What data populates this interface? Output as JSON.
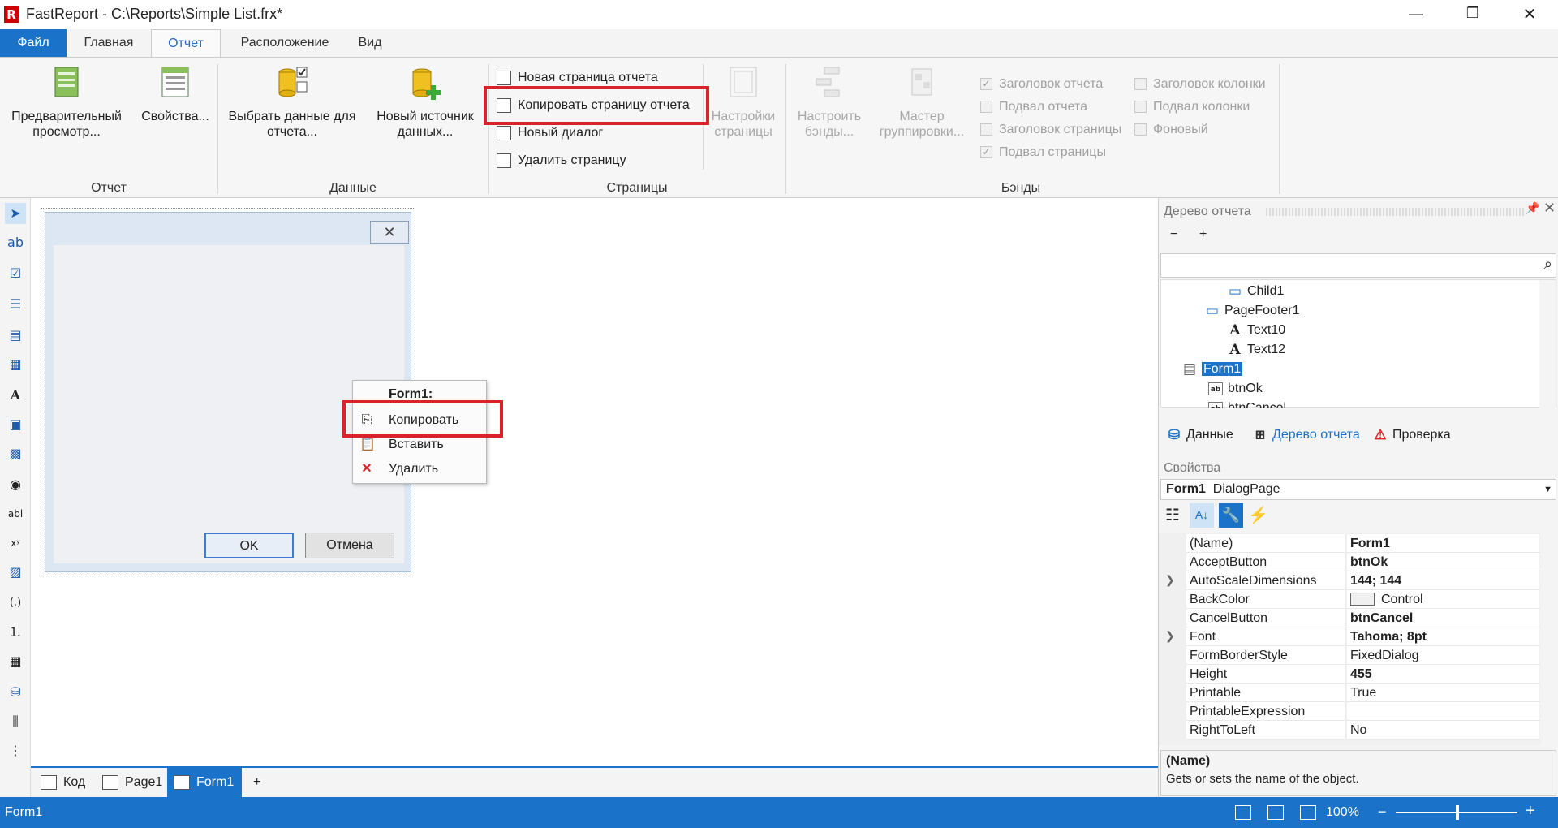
{
  "window": {
    "logo": "R",
    "title": "FastReport - C:\\Reports\\Simple List.frx*",
    "minimize": "—",
    "restore": "❐",
    "close": "✕"
  },
  "menu_tabs": [
    "Файл",
    "Главная",
    "Отчет",
    "Расположение",
    "Вид"
  ],
  "ribbon": {
    "group_report": {
      "label": "Отчет",
      "preview": "Предварительный просмотр...",
      "properties": "Свойства..."
    },
    "group_data": {
      "label": "Данные",
      "choose_data": "Выбрать данные для отчета...",
      "new_source": "Новый источник данных..."
    },
    "group_pages": {
      "label": "Страницы",
      "new_page": "Новая страница отчета",
      "copy_page": "Копировать страницу отчета",
      "new_dialog": "Новый диалог",
      "delete_page": "Удалить страницу",
      "page_settings": "Настройки страницы"
    },
    "group_bands": {
      "label": "Бэнды",
      "configure": "Настроить бэнды...",
      "group_wizard": "Мастер группировки...",
      "checks": [
        {
          "label": "Заголовок отчета",
          "checked": true
        },
        {
          "label": "Подвал отчета",
          "checked": false
        },
        {
          "label": "Заголовок страницы",
          "checked": false
        },
        {
          "label": "Подвал страницы",
          "checked": true
        },
        {
          "label": "Заголовок колонки",
          "checked": false
        },
        {
          "label": "Подвал колонки",
          "checked": false
        },
        {
          "label": "Фоновый",
          "checked": false
        }
      ]
    }
  },
  "dialog": {
    "close_glyph": "✕",
    "ok": "OK",
    "cancel": "Отмена"
  },
  "context_menu": {
    "title": "Form1:",
    "copy": "Копировать",
    "paste": "Вставить",
    "delete": "Удалить"
  },
  "bottom_tabs": [
    "Код",
    "Page1",
    "Form1",
    "+"
  ],
  "status": {
    "left": "Form1",
    "zoom": "100%",
    "minus": "−",
    "plus": "+"
  },
  "tree_panel": {
    "title": "Дерево отчета",
    "collapse": "−",
    "expand": "+",
    "search_placeholder": "",
    "items": [
      "Child1",
      "PageFooter1",
      "Text10",
      "Text12",
      "Form1",
      "btnOk",
      "btnCancel"
    ],
    "tabs": [
      "Данные",
      "Дерево отчета",
      "Проверка"
    ]
  },
  "props_panel": {
    "title": "Свойства",
    "object_name": "Form1",
    "object_type": "DialogPage",
    "rows": [
      {
        "name": "(Name)",
        "value": "Form1",
        "bold": true
      },
      {
        "name": "AcceptButton",
        "value": "btnOk",
        "bold": true
      },
      {
        "name": "AutoScaleDimensions",
        "value": "144; 144",
        "bold": true
      },
      {
        "name": "BackColor",
        "value": "Control",
        "bold": false
      },
      {
        "name": "CancelButton",
        "value": "btnCancel",
        "bold": true
      },
      {
        "name": "Font",
        "value": "Tahoma; 8pt",
        "bold": true
      },
      {
        "name": "FormBorderStyle",
        "value": "FixedDialog",
        "bold": false
      },
      {
        "name": "Height",
        "value": "455",
        "bold": true
      },
      {
        "name": "Printable",
        "value": "True",
        "bold": false
      },
      {
        "name": "PrintableExpression",
        "value": "",
        "bold": false
      },
      {
        "name": "RightToLeft",
        "value": "No",
        "bold": false
      }
    ],
    "desc_title": "(Name)",
    "desc_text": "Gets or sets the name of the object."
  },
  "colors": {
    "accent": "#1a73c8",
    "highlight": "#d8232a"
  }
}
